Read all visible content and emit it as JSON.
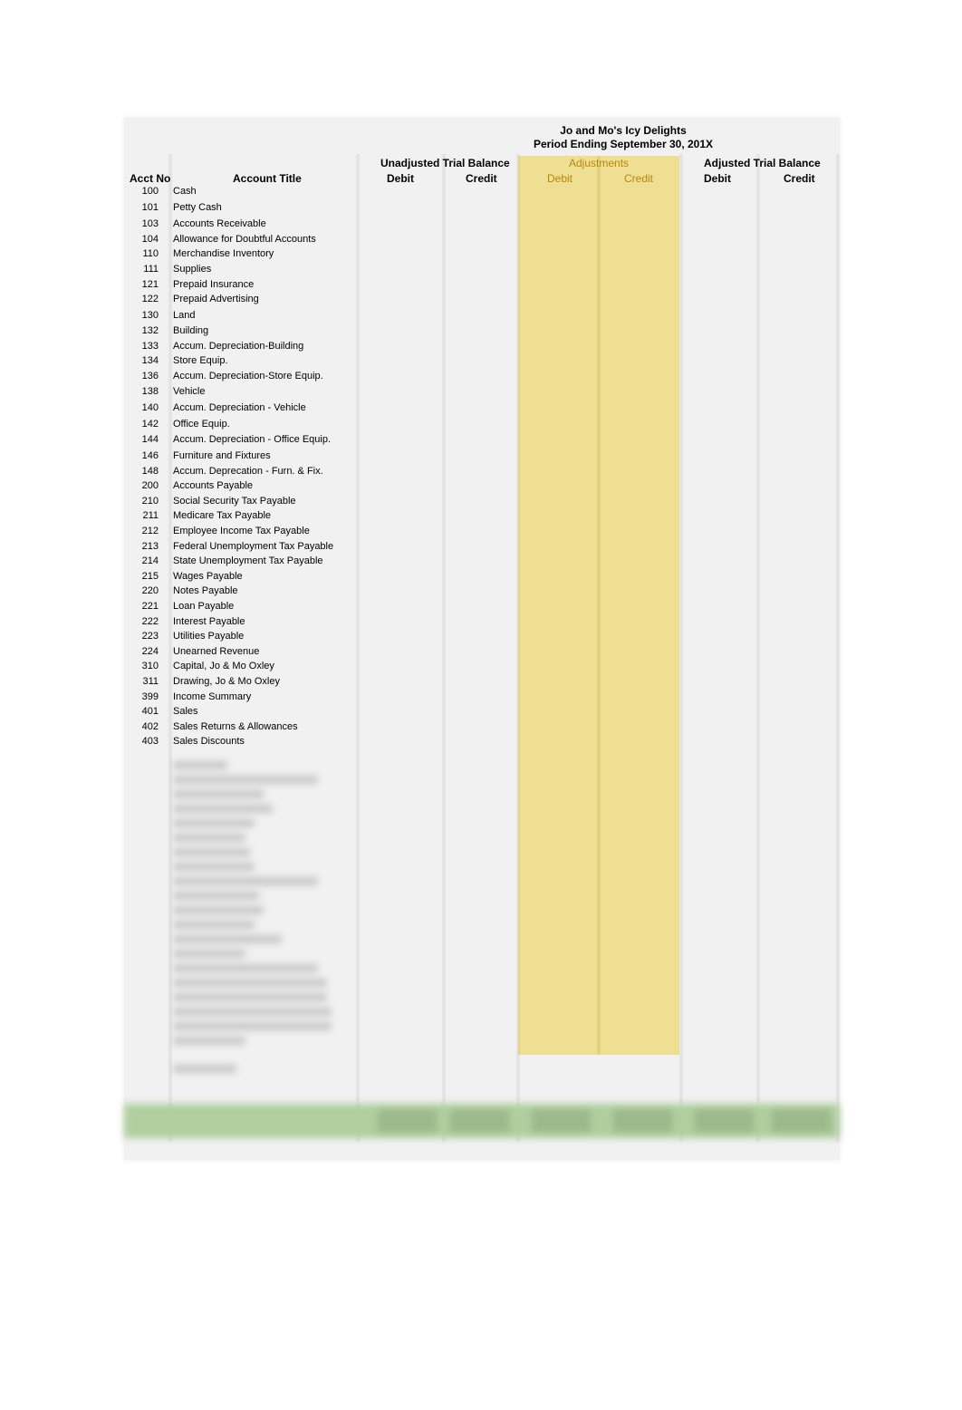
{
  "document": {
    "company": "Jo and Mo's Icy Delights",
    "period": "Period Ending September 30, 201X"
  },
  "columns": {
    "acct_no": "Acct No",
    "account_title": "Account Title",
    "unadjusted": {
      "label": "Unadjusted Trial Balance",
      "debit": "Debit",
      "credit": "Credit"
    },
    "adjustments": {
      "label": "Adjustments",
      "debit": "Debit",
      "credit": "Credit"
    },
    "adjusted": {
      "label": "Adjusted Trial Balance",
      "debit": "Debit",
      "credit": "Credit"
    }
  },
  "accounts": [
    {
      "no": "100",
      "title": "Cash"
    },
    {
      "no": "101",
      "title": "Petty Cash"
    },
    {
      "no": "103",
      "title": "Accounts Receivable"
    },
    {
      "no": "104",
      "title": "Allowance for Doubtful Accounts"
    },
    {
      "no": "110",
      "title": "Merchandise Inventory"
    },
    {
      "no": "111",
      "title": "Supplies"
    },
    {
      "no": "121",
      "title": "Prepaid Insurance"
    },
    {
      "no": "122",
      "title": "Prepaid Advertising"
    },
    {
      "no": "130",
      "title": "Land"
    },
    {
      "no": "132",
      "title": "Building"
    },
    {
      "no": "133",
      "title": "Accum. Depreciation-Building"
    },
    {
      "no": "134",
      "title": "Store Equip."
    },
    {
      "no": "136",
      "title": "Accum. Depreciation-Store Equip."
    },
    {
      "no": "138",
      "title": "Vehicle"
    },
    {
      "no": "140",
      "title": "Accum. Depreciation - Vehicle"
    },
    {
      "no": "142",
      "title": "Office Equip."
    },
    {
      "no": "144",
      "title": "Accum. Depreciation - Office Equip."
    },
    {
      "no": "146",
      "title": "Furniture and Fixtures"
    },
    {
      "no": "148",
      "title": "Accum. Deprecation - Furn. & Fix."
    },
    {
      "no": "200",
      "title": "Accounts Payable"
    },
    {
      "no": "210",
      "title": "Social Security Tax Payable"
    },
    {
      "no": "211",
      "title": "Medicare Tax Payable"
    },
    {
      "no": "212",
      "title": "Employee Income Tax Payable"
    },
    {
      "no": "213",
      "title": "Federal Unemployment Tax Payable"
    },
    {
      "no": "214",
      "title": "State Unemployment Tax Payable"
    },
    {
      "no": "215",
      "title": "Wages Payable"
    },
    {
      "no": "220",
      "title": "Notes Payable"
    },
    {
      "no": "221",
      "title": "Loan Payable"
    },
    {
      "no": "222",
      "title": "Interest Payable"
    },
    {
      "no": "223",
      "title": "Utilities Payable"
    },
    {
      "no": "224",
      "title": "Unearned Revenue"
    },
    {
      "no": "310",
      "title": "Capital, Jo & Mo Oxley"
    },
    {
      "no": "311",
      "title": "Drawing, Jo & Mo Oxley"
    },
    {
      "no": "399",
      "title": "Income Summary"
    },
    {
      "no": "401",
      "title": "Sales"
    },
    {
      "no": "402",
      "title": "Sales Returns & Allowances"
    },
    {
      "no": "403",
      "title": "Sales Discounts"
    }
  ],
  "colors": {
    "adjustments_fill": "#efdf92",
    "adjustments_text": "#b8860b",
    "totals_fill": "#afcf9f",
    "sheet_fill": "#f1f1f1"
  }
}
